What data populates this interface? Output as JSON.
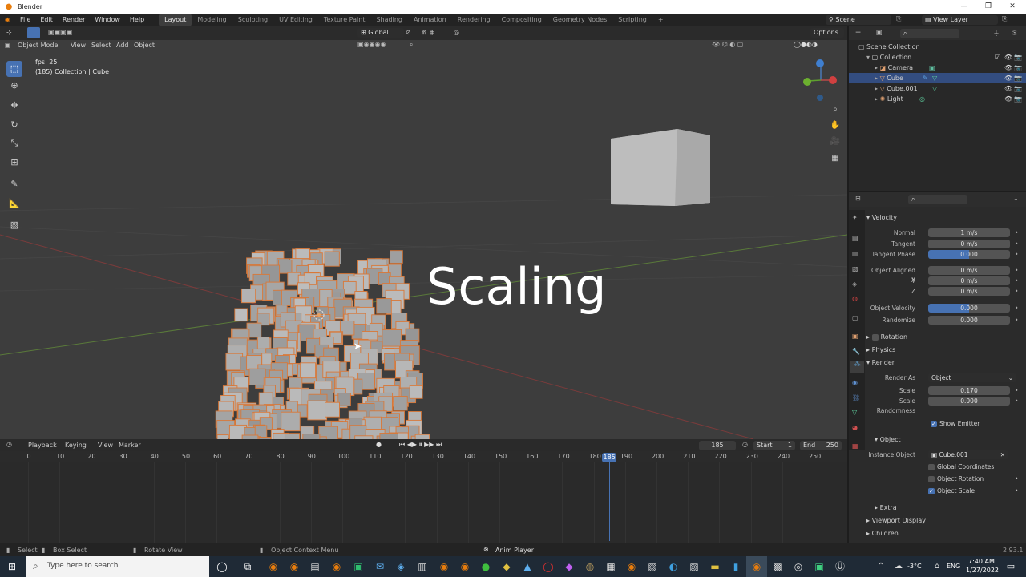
{
  "window": {
    "title": "Blender"
  },
  "menubar": {
    "menus": [
      "File",
      "Edit",
      "Render",
      "Window",
      "Help"
    ],
    "workspaces": [
      "Layout",
      "Modeling",
      "Sculpting",
      "UV Editing",
      "Texture Paint",
      "Shading",
      "Animation",
      "Rendering",
      "Compositing",
      "Geometry Nodes",
      "Scripting"
    ],
    "active_workspace": "Layout",
    "add_tab": "+",
    "scene": "Scene",
    "view_layer": "View Layer"
  },
  "viewport": {
    "orientation": "Global",
    "options": "Options",
    "mode": "Object Mode",
    "menus": [
      "View",
      "Select",
      "Add",
      "Object"
    ],
    "fps": "fps: 25",
    "collection_info": "(185) Collection | Cube",
    "overlay_text": "Scaling"
  },
  "timeline": {
    "menus": [
      "Playback",
      "Keying",
      "View",
      "Marker"
    ],
    "current_frame": "185",
    "start_label": "Start",
    "start": "1",
    "end_label": "End",
    "end": "250",
    "ticks": [
      "0",
      "10",
      "20",
      "30",
      "40",
      "50",
      "60",
      "70",
      "80",
      "90",
      "100",
      "110",
      "120",
      "130",
      "140",
      "150",
      "160",
      "170",
      "180",
      "190",
      "200",
      "210",
      "220",
      "230",
      "240",
      "250"
    ],
    "playhead": "185"
  },
  "outliner": {
    "root": "Scene Collection",
    "collection": "Collection",
    "items": [
      {
        "name": "Camera",
        "selected": false
      },
      {
        "name": "Cube",
        "selected": true
      },
      {
        "name": "Cube.001",
        "selected": false
      },
      {
        "name": "Light",
        "selected": false
      }
    ]
  },
  "properties": {
    "velocity": {
      "header": "Velocity",
      "normal_label": "Normal",
      "normal": "1 m/s",
      "tangent_label": "Tangent",
      "tangent": "0 m/s",
      "tangent_phase_label": "Tangent Phase",
      "tangent_phase": "0.000",
      "aligned_x_label": "Object Aligned X",
      "aligned_x": "0 m/s",
      "y_label": "Y",
      "y": "0 m/s",
      "z_label": "Z",
      "z": "0 m/s",
      "object_velocity_label": "Object Velocity",
      "object_velocity": "0.000",
      "randomize_label": "Randomize",
      "randomize": "0.000"
    },
    "rotation": "Rotation",
    "physics": "Physics",
    "render": {
      "header": "Render",
      "render_as_label": "Render As",
      "render_as": "Object",
      "scale_label": "Scale",
      "scale": "0.170",
      "scale_random_label": "Scale Randomness",
      "scale_random": "0.000",
      "show_emitter": "Show Emitter"
    },
    "object": {
      "header": "Object",
      "instance_label": "Instance Object",
      "instance": "Cube.001",
      "global_coords": "Global Coordinates",
      "object_rotation": "Object Rotation",
      "object_scale": "Object Scale"
    },
    "extra": "Extra",
    "viewport_display": "Viewport Display",
    "children": "Children"
  },
  "statusbar": {
    "select": "Select",
    "box_select": "Box Select",
    "rotate_view": "Rotate View",
    "context_menu": "Object Context Menu",
    "anim_player": "Anim Player",
    "version": "2.93.1"
  },
  "taskbar": {
    "search_placeholder": "Type here to search",
    "weather": "-3°C",
    "lang": "ENG",
    "time": "7:40 AM",
    "date": "1/27/2022"
  }
}
